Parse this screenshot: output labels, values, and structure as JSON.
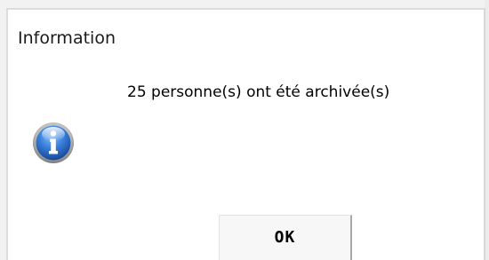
{
  "dialog": {
    "title": "Information",
    "message": "25 personne(s) ont été archivée(s)",
    "icon": "information-icon",
    "ok_label": "OK"
  },
  "colors": {
    "icon_blue": "#1f5fb8",
    "icon_light": "#8fc0f5",
    "background": "#ffffff"
  }
}
